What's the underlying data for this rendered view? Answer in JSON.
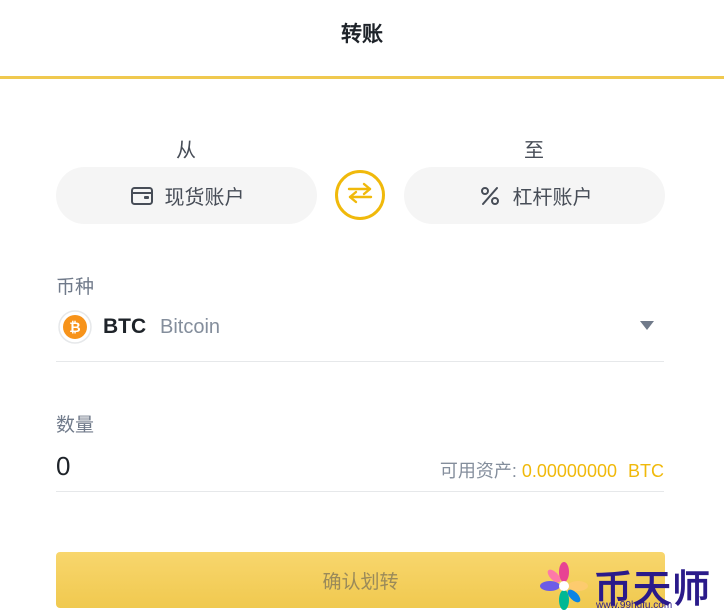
{
  "header": {
    "title": "转账"
  },
  "transfer": {
    "from_label": "从",
    "to_label": "至",
    "from_account": {
      "label": "现货账户",
      "icon": "wallet-icon"
    },
    "to_account": {
      "label": "杠杆账户",
      "icon": "percent-icon"
    },
    "swap_icon": "swap-arrows-icon"
  },
  "coin": {
    "label": "币种",
    "symbol": "BTC",
    "name": "Bitcoin",
    "icon": "bitcoin-icon",
    "icon_color": "#f7931a"
  },
  "amount": {
    "label": "数量",
    "value": "0",
    "available_label": "可用资产:",
    "available_value": "0.00000000",
    "available_currency": "BTC"
  },
  "confirm": {
    "label": "确认划转"
  },
  "watermark": {
    "text": "币天师",
    "url": "www.99hufu.com"
  },
  "colors": {
    "accent": "#f0b90b",
    "header_line": "#f0c94f",
    "button": "#f0c94f"
  }
}
